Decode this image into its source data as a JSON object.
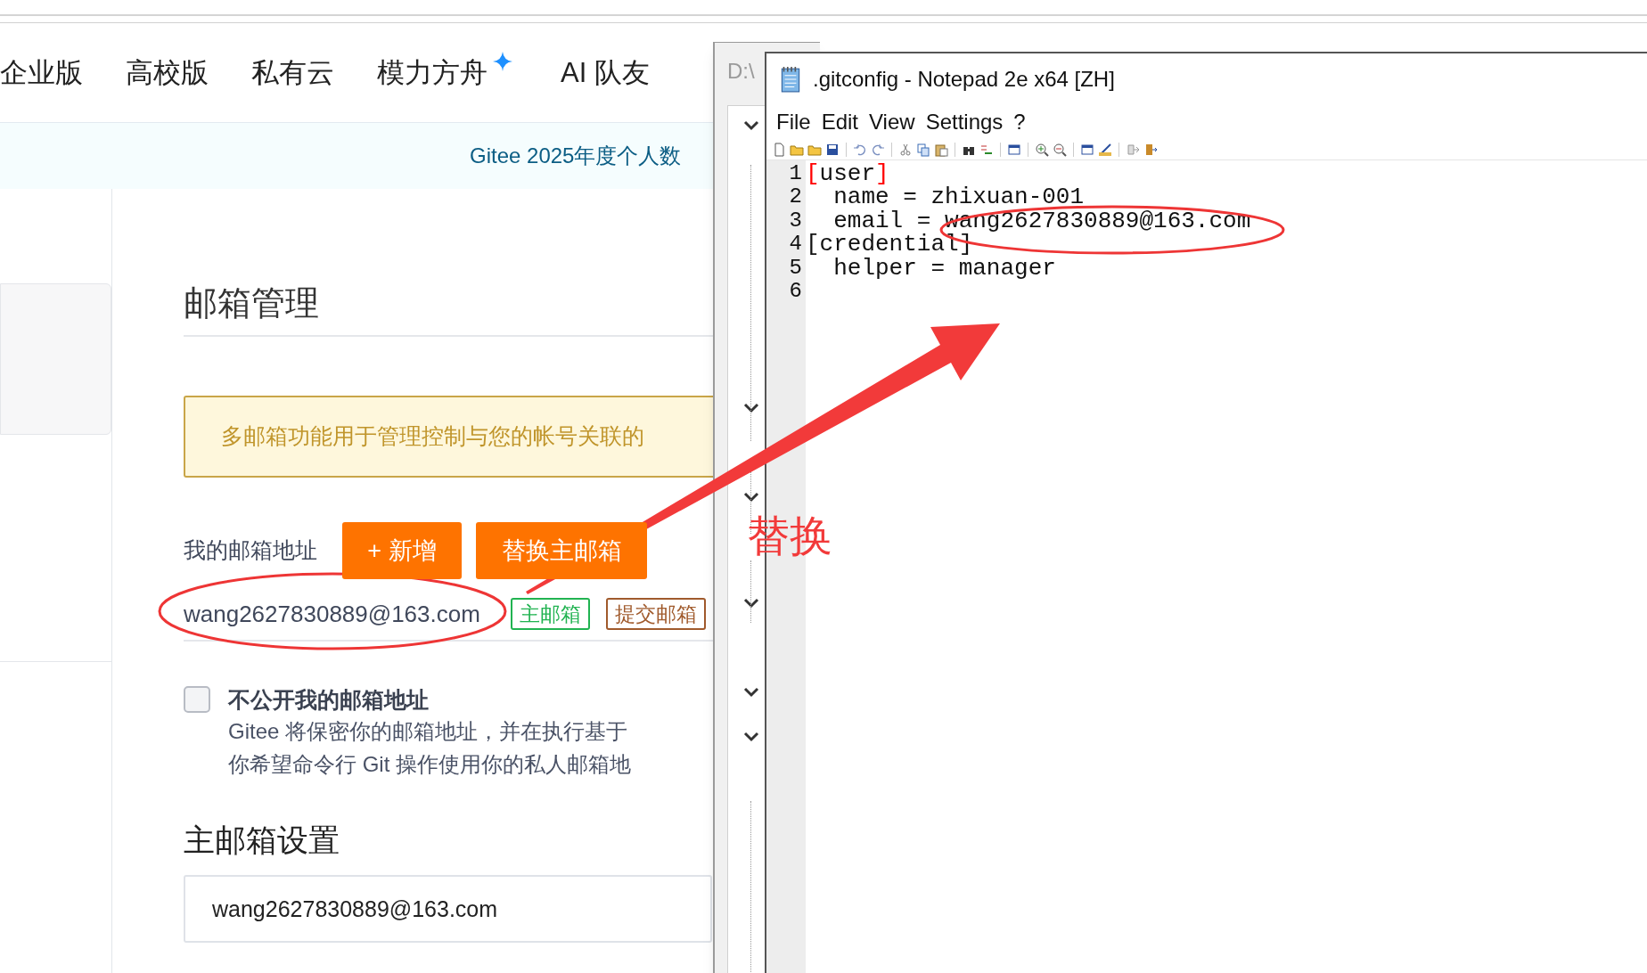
{
  "browser": {
    "nav": [
      {
        "label": "企业版",
        "starred": false
      },
      {
        "label": "高校版",
        "starred": false
      },
      {
        "label": "私有云",
        "starred": false
      },
      {
        "label": "模力方舟",
        "starred": true
      },
      {
        "label": "AI 队友",
        "starred": false
      }
    ],
    "banner": "Gitee 2025年度个人数",
    "page": {
      "title": "邮箱管理",
      "notice": "多邮箱功能用于管理控制与您的帐号关联的",
      "address_label": "我的邮箱地址",
      "buttons": [
        "+ 新增",
        "替换主邮箱"
      ],
      "emails": [
        {
          "address": "wang2627830889@163.com",
          "tags": [
            {
              "label": "主邮箱",
              "kind": "primary"
            },
            {
              "label": "提交邮箱",
              "kind": "commit"
            }
          ]
        }
      ],
      "privacy": {
        "label": "不公开我的邮箱地址",
        "checked": false,
        "description": [
          "Gitee 将保密你的邮箱地址，并在执行基于",
          "你希望命令行 Git 操作使用你的私人邮箱地"
        ]
      },
      "primary_section": {
        "title": "主邮箱设置",
        "value": "wang2627830889@163.com"
      }
    }
  },
  "background_window": {
    "title": "D:\\"
  },
  "notepad": {
    "title": ".gitconfig - Notepad 2e x64 [ZH]",
    "menu": [
      "File",
      "Edit",
      "View",
      "Settings",
      "?"
    ],
    "lines": [
      {
        "number": "1",
        "text": "[user]",
        "bracket_match": true
      },
      {
        "number": "2",
        "text": "  name = zhixuan-001"
      },
      {
        "number": "3",
        "text": "  email = wang2627830889@163.com"
      },
      {
        "number": "4",
        "text": "[credential]",
        "bracket_match": false
      },
      {
        "number": "5",
        "text": "  helper = manager"
      },
      {
        "number": "6"
      }
    ]
  },
  "annotation": {
    "label": "替换"
  }
}
